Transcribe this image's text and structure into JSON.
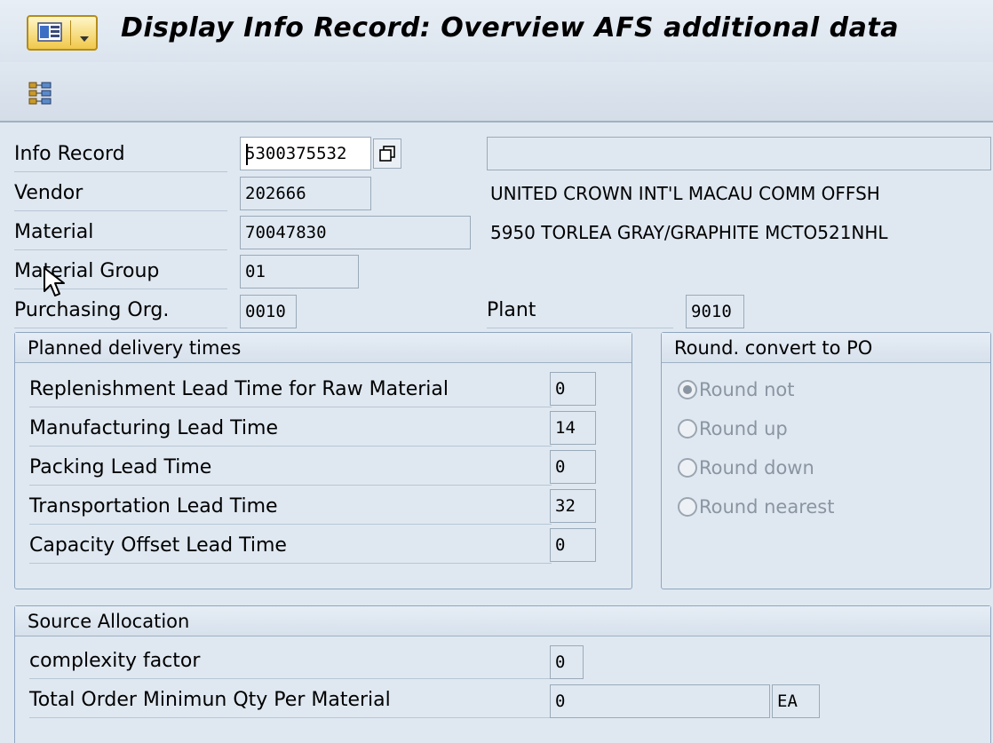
{
  "title": "Display Info Record: Overview AFS additional data",
  "icons": {
    "menu": "system-menu-icon",
    "toolbar_structure": "structure-icon",
    "copy": "copy-icon",
    "cursor": "mouse-pointer-icon"
  },
  "header_fields": {
    "info_record_label": "Info Record",
    "info_record_value": "5300375532",
    "vendor_label": "Vendor",
    "vendor_value": "202666",
    "vendor_name": "UNITED CROWN INT'L MACAU COMM OFFSH",
    "material_label": "Material",
    "material_value": "70047830",
    "material_desc": "5950 TORLEA GRAY/GRAPHITE MCTO521NHL",
    "material_group_label": "Material Group",
    "material_group_value": "01",
    "purch_org_label": "Purchasing Org.",
    "purch_org_value": "0010",
    "plant_label": "Plant",
    "plant_value": "9010"
  },
  "planned_delivery": {
    "title": "Planned delivery times",
    "rows": [
      {
        "label": "Replenishment Lead Time for Raw Material",
        "value": "0"
      },
      {
        "label": "Manufacturing Lead Time",
        "value": "14"
      },
      {
        "label": "Packing Lead Time",
        "value": "0"
      },
      {
        "label": "Transportation Lead Time",
        "value": "32"
      },
      {
        "label": "Capacity Offset Lead Time",
        "value": "0"
      }
    ]
  },
  "rounding": {
    "title": "Round. convert to PO",
    "options": [
      "Round not",
      "Round up",
      "Round down",
      "Round nearest"
    ],
    "selected": "Round not"
  },
  "source_allocation": {
    "title": "Source Allocation",
    "complexity_label": "complexity factor",
    "complexity_value": "0",
    "min_qty_label": "Total Order Minimun Qty Per Material",
    "min_qty_value": "0",
    "min_qty_unit": "EA"
  }
}
